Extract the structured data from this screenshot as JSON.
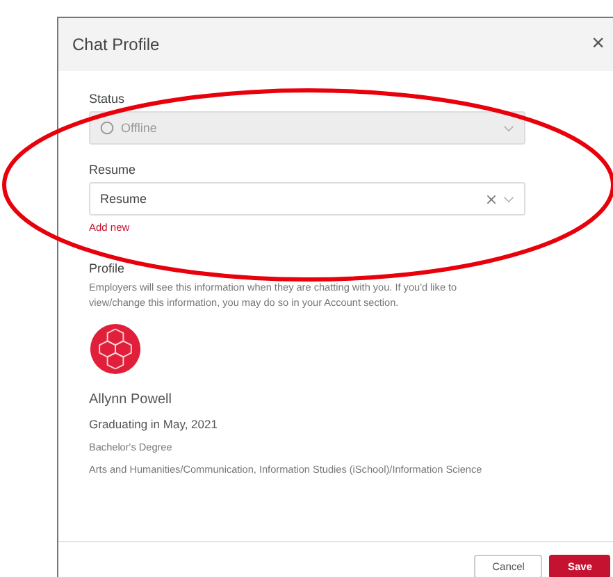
{
  "dialog": {
    "title": "Chat Profile",
    "close": "×"
  },
  "fields": [
    {
      "label": "Status",
      "value": "Offline",
      "disabled": true,
      "clearable": false,
      "status_icon": true
    },
    {
      "label": "Resume",
      "value": "Resume",
      "disabled": false,
      "clearable": true,
      "status_icon": false
    }
  ],
  "add_new": "Add new",
  "profile": {
    "heading": "Profile",
    "description": "Employers will see this information when they are chatting with you. If you'd like to view/change this information, you may do so in your Account section.",
    "name": "Allynn Powell",
    "graduation": "Graduating in May, 2021",
    "degree": "Bachelor's Degree",
    "major": "Arts and Humanities/Communication, Information Studies (iSchool)/Information Science"
  },
  "buttons": [
    {
      "label": "Cancel",
      "kind": "secondary"
    },
    {
      "label": "Save",
      "kind": "primary"
    }
  ]
}
